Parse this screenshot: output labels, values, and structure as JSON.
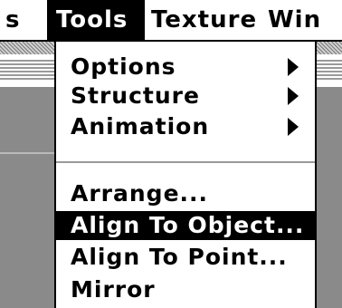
{
  "menubar": {
    "items": [
      {
        "label": "s",
        "active": false
      },
      {
        "label": "Tools",
        "active": true
      },
      {
        "label": "Texture",
        "active": false
      },
      {
        "label": "Win",
        "active": false
      }
    ]
  },
  "tools_menu": {
    "items": [
      {
        "label": "Options",
        "submenu": true,
        "selected": false
      },
      {
        "label": "Structure",
        "submenu": true,
        "selected": false
      },
      {
        "label": "Animation",
        "submenu": true,
        "selected": false
      },
      {
        "label": "Arrange...",
        "submenu": false,
        "selected": false
      },
      {
        "label": "Align To Object...",
        "submenu": false,
        "selected": true
      },
      {
        "label": "Align To Point...",
        "submenu": false,
        "selected": false
      },
      {
        "label": "Mirror",
        "submenu": false,
        "selected": false
      }
    ]
  },
  "colors": {
    "highlight": "#000000",
    "highlight_text": "#ffffff",
    "backdrop_gray": "#8a8a8a"
  }
}
